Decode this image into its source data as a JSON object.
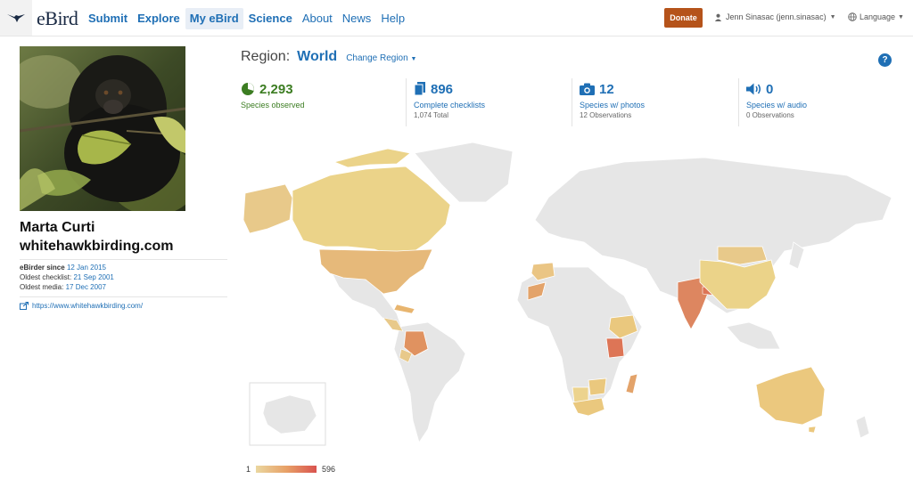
{
  "header": {
    "brand": "eBird",
    "nav": [
      {
        "label": "Submit"
      },
      {
        "label": "Explore"
      },
      {
        "label": "My eBird",
        "active": true
      },
      {
        "label": "Science"
      },
      {
        "label": "About"
      },
      {
        "label": "News"
      },
      {
        "label": "Help"
      }
    ],
    "donate_label": "Donate",
    "user_label": "Jenn Sinasac (jenn.sinasac)",
    "language_label": "Language",
    "donate_color": "#b5531a"
  },
  "profile": {
    "name_line1": "Marta Curti",
    "name_line2": "whitehawkbirding.com",
    "since_label": "eBirder since",
    "since_value": "12 Jan 2015",
    "oldest_checklist_label": "Oldest checklist:",
    "oldest_checklist_value": "21 Sep 2001",
    "oldest_media_label": "Oldest media:",
    "oldest_media_value": "17 Dec 2007",
    "website": "https://www.whitehawkbirding.com/"
  },
  "region": {
    "label": "Region:",
    "value": "World",
    "change_label": "Change Region"
  },
  "stats": [
    {
      "value": "2,293",
      "label": "Species observed",
      "sub": ""
    },
    {
      "value": "896",
      "label": "Complete checklists",
      "sub": "1,074 Total"
    },
    {
      "value": "12",
      "label": "Species w/ photos",
      "sub": "12 Observations"
    },
    {
      "value": "0",
      "label": "Species w/ audio",
      "sub": "0 Observations"
    }
  ],
  "legend": {
    "min": "1",
    "max": "596",
    "color_low": "#ead7a0",
    "color_mid": "#e8a167",
    "color_high": "#d9534f"
  },
  "colors": {
    "accent": "#1f6fb5",
    "green": "#3c7d22",
    "land_gray": "#e6e6e6"
  }
}
